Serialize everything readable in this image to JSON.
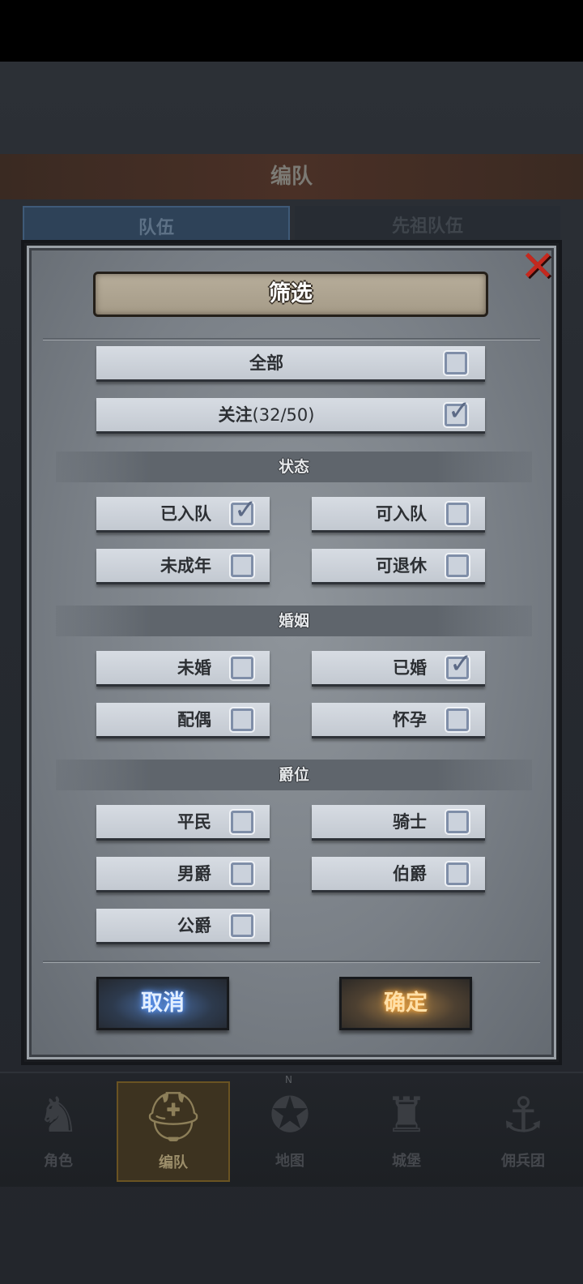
{
  "background": {
    "header_title": "编队",
    "tabs": [
      "队伍",
      "先祖队伍"
    ],
    "nav": [
      {
        "label": "角色",
        "icon": "knight-icon"
      },
      {
        "label": "编队",
        "icon": "helmet-icon"
      },
      {
        "label": "地图",
        "icon": "compass-icon"
      },
      {
        "label": "城堡",
        "icon": "castle-icon"
      },
      {
        "label": "佣兵团",
        "icon": "ship-icon"
      }
    ],
    "compass_n": "N"
  },
  "dialog": {
    "title": "筛选",
    "close_icon": "close-icon",
    "all": {
      "label": "全部",
      "checked": false
    },
    "follow": {
      "label": "关注",
      "count": "(32/50)",
      "checked": true
    },
    "sections": [
      {
        "title": "状态",
        "options": [
          {
            "label": "已入队",
            "checked": true
          },
          {
            "label": "可入队",
            "checked": false
          },
          {
            "label": "未成年",
            "checked": false
          },
          {
            "label": "可退休",
            "checked": false
          }
        ]
      },
      {
        "title": "婚姻",
        "options": [
          {
            "label": "未婚",
            "checked": false
          },
          {
            "label": "已婚",
            "checked": true
          },
          {
            "label": "配偶",
            "checked": false
          },
          {
            "label": "怀孕",
            "checked": false
          }
        ]
      },
      {
        "title": "爵位",
        "options": [
          {
            "label": "平民",
            "checked": false
          },
          {
            "label": "骑士",
            "checked": false
          },
          {
            "label": "男爵",
            "checked": false
          },
          {
            "label": "伯爵",
            "checked": false
          },
          {
            "label": "公爵",
            "checked": false
          }
        ]
      }
    ],
    "cancel_label": "取消",
    "confirm_label": "确定"
  }
}
